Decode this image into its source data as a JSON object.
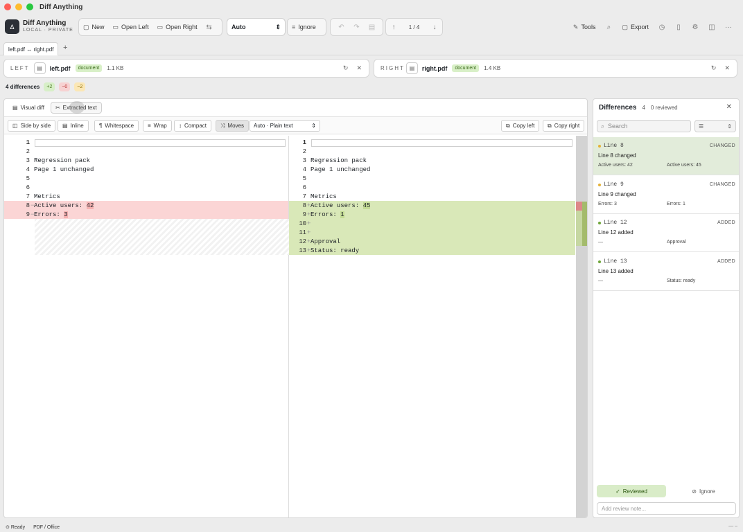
{
  "window": {
    "title": "Diff Anything"
  },
  "brand": {
    "name": "Diff Anything",
    "subtitle": "LOCAL · PRIVATE"
  },
  "toolbar": {
    "new_label": "New",
    "open_left_label": "Open Left",
    "open_right_label": "Open Right",
    "mode_select": "Auto",
    "ignore_label": "Ignore",
    "nav_counter": "1 / 4",
    "tools_label": "Tools",
    "export_label": "Export"
  },
  "tab": {
    "label": "left.pdf ↔ right.pdf"
  },
  "left_file": {
    "side": "LEFT",
    "name": "left.pdf",
    "badge": "document",
    "size": "1.1 KB"
  },
  "right_file": {
    "side": "RIGHT",
    "name": "right.pdf",
    "badge": "document",
    "size": "1.4 KB"
  },
  "summary": {
    "text": "4 differences",
    "added": "+2",
    "removed": "−0",
    "changed": "~2"
  },
  "view_tabs": {
    "visual": "Visual diff",
    "extracted": "Extracted text"
  },
  "options": {
    "side_by_side": "Side by side",
    "inline": "Inline",
    "whitespace": "Whitespace",
    "wrap": "Wrap",
    "compact": "Compact",
    "moves": "Moves",
    "format_select": "Auto · Plain text",
    "copy_left": "Copy left",
    "copy_right": "Copy right"
  },
  "left_lines": [
    {
      "n": "1",
      "text": ""
    },
    {
      "n": "2",
      "text": ""
    },
    {
      "n": "3",
      "text": "Regression pack"
    },
    {
      "n": "4",
      "text": "Page 1 unchanged"
    },
    {
      "n": "5",
      "text": ""
    },
    {
      "n": "6",
      "text": ""
    },
    {
      "n": "7",
      "text": "Metrics"
    },
    {
      "n": "8",
      "marker": "−",
      "prefix": "Active users: ",
      "hl": "42"
    },
    {
      "n": "9",
      "marker": "−",
      "prefix": "Errors: ",
      "hl": "3"
    }
  ],
  "right_lines": [
    {
      "n": "1",
      "text": ""
    },
    {
      "n": "2",
      "text": ""
    },
    {
      "n": "3",
      "text": "Regression pack"
    },
    {
      "n": "4",
      "text": "Page 1 unchanged"
    },
    {
      "n": "5",
      "text": ""
    },
    {
      "n": "6",
      "text": ""
    },
    {
      "n": "7",
      "text": "Metrics"
    },
    {
      "n": "8",
      "marker": "+",
      "prefix": "Active users: ",
      "hl": "45"
    },
    {
      "n": "9",
      "marker": "+",
      "prefix": "Errors: ",
      "hl": "1"
    },
    {
      "n": "10",
      "marker": "+",
      "text": ""
    },
    {
      "n": "11",
      "marker": "+",
      "text": ""
    },
    {
      "n": "12",
      "marker": "+",
      "text": "Approval"
    },
    {
      "n": "13",
      "marker": "+",
      "text": "Status: ready"
    }
  ],
  "differences": {
    "title": "Differences",
    "count": "4",
    "reviewed": "0 reviewed",
    "search_placeholder": "Search",
    "items": [
      {
        "line": "Line 8",
        "kind": "CHANGED",
        "desc": "Line 8 changed",
        "left": "Active users: 42",
        "right": "Active users: 45"
      },
      {
        "line": "Line 9",
        "kind": "CHANGED",
        "desc": "Line 9 changed",
        "left": "Errors: 3",
        "right": "Errors: 1"
      },
      {
        "line": "Line 12",
        "kind": "ADDED",
        "desc": "Line 12 added",
        "left": "—",
        "right": "Approval"
      },
      {
        "line": "Line 13",
        "kind": "ADDED",
        "desc": "Line 13 added",
        "left": "—",
        "right": "Status: ready"
      }
    ],
    "reviewed_button": "Reviewed",
    "ignore_button": "Ignore",
    "note_placeholder": "Add review note..."
  },
  "status": {
    "ready": "Ready",
    "format": "PDF / Office",
    "zoom": "— –"
  }
}
